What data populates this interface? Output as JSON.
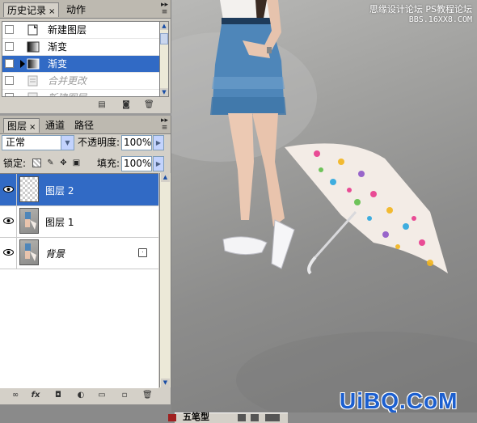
{
  "history": {
    "tabs": [
      {
        "label": "历史记录",
        "close": "×"
      },
      {
        "label": "动作"
      }
    ],
    "items": [
      {
        "label": "新建图层",
        "state": "normal"
      },
      {
        "label": "渐变",
        "state": "normal"
      },
      {
        "label": "渐变",
        "state": "selected"
      },
      {
        "label": "合并更改",
        "state": "dim"
      },
      {
        "label": "新建图层",
        "state": "dim"
      }
    ]
  },
  "layers": {
    "tabs": [
      {
        "label": "图层",
        "close": "×"
      },
      {
        "label": "通道"
      },
      {
        "label": "路径"
      }
    ],
    "blend_mode": "正常",
    "opacity_label": "不透明度:",
    "opacity_value": "100%",
    "lock_label": "锁定:",
    "fill_label": "填充:",
    "fill_value": "100%",
    "items": [
      {
        "name": "图层 2",
        "selected": true,
        "thumb": "transparent"
      },
      {
        "name": "图层 1",
        "selected": false,
        "thumb": "photo"
      },
      {
        "name": "背景",
        "selected": false,
        "thumb": "photo",
        "locked": true
      }
    ]
  },
  "watermark": {
    "top_line1": "思缘设计论坛",
    "top_line2": "PS教程论坛",
    "top_site": "BBS.16XX8.COM",
    "bottom": "UiBQ.CoM"
  },
  "taskbar": {
    "ime_label": "五笔型"
  },
  "colors": {
    "selection": "#316ac5",
    "watermark_blue": "#1c5fcf",
    "panel_bg": "#d4d0c8"
  }
}
